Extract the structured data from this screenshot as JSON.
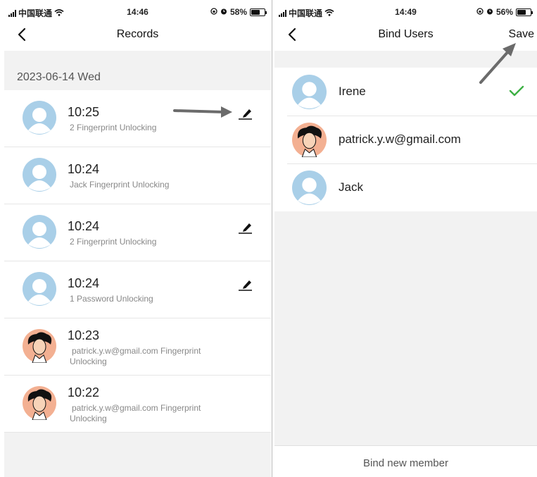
{
  "left_screen": {
    "status": {
      "carrier": "中国联通",
      "time": "14:46",
      "battery": "58%"
    },
    "nav": {
      "title": "Records"
    },
    "date_header": "2023-06-14 Wed",
    "records": [
      {
        "time": "10:25",
        "desc": "2 Fingerprint Unlocking",
        "avatar": "default-avatar",
        "editable": true
      },
      {
        "time": "10:24",
        "desc": "Jack Fingerprint Unlocking",
        "avatar": "default-avatar",
        "editable": false
      },
      {
        "time": "10:24",
        "desc": "2 Fingerprint Unlocking",
        "avatar": "default-avatar",
        "editable": true
      },
      {
        "time": "10:24",
        "desc": "1 Password Unlocking",
        "avatar": "default-avatar",
        "editable": true
      },
      {
        "time": "10:23",
        "desc": "patrick.y.w@gmail.com Fingerprint Unlocking",
        "avatar": "cartoon-avatar",
        "editable": false
      },
      {
        "time": "10:22",
        "desc": "patrick.y.w@gmail.com Fingerprint Unlocking",
        "avatar": "cartoon-avatar",
        "editable": false
      }
    ]
  },
  "right_screen": {
    "status": {
      "carrier": "中国联通",
      "time": "14:49",
      "battery": "56%"
    },
    "nav": {
      "title": "Bind Users",
      "save_label": "Save"
    },
    "users": [
      {
        "name": "Irene",
        "avatar": "default-avatar",
        "selected": true
      },
      {
        "name": "patrick.y.w@gmail.com",
        "avatar": "cartoon-avatar",
        "selected": false
      },
      {
        "name": "Jack",
        "avatar": "default-avatar",
        "selected": false
      }
    ],
    "bind_new_label": "Bind new member"
  },
  "colors": {
    "avatar_blue": "#a9cfe8",
    "check_green": "#3cb043",
    "background_gray": "#f2f2f2",
    "annotation_arrow": "#6b6b6b"
  }
}
